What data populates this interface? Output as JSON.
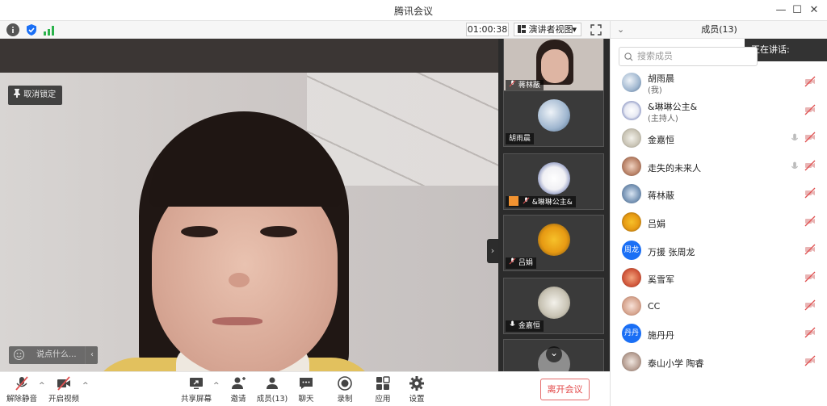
{
  "window": {
    "title": "腾讯会议",
    "minimize": "—",
    "maximize": "☐",
    "close": "✕"
  },
  "status": {
    "timer": "01:00:38",
    "view_mode": "演讲者视图",
    "view_caret": "▾"
  },
  "main_video": {
    "unlock_label": "取消锁定",
    "chat_placeholder": "说点什么...",
    "chat_arrow": "‹",
    "collapse_arrow": "›"
  },
  "strip": {
    "tiles": [
      {
        "name": "蒋林蔽"
      },
      {
        "name": "胡雨晨"
      },
      {
        "name": "&琳琳公主&"
      },
      {
        "name": "吕娟"
      },
      {
        "name": "金嘉恒"
      }
    ],
    "scroll_down": "⌄"
  },
  "panel": {
    "title": "成员(13)",
    "collapse": "⌄",
    "speaking_label": "正在讲话:",
    "search_placeholder": "搜索成员",
    "members": [
      {
        "name": "胡雨晨",
        "role": "(我)"
      },
      {
        "name": "&琳琳公主&",
        "role": "(主持人)"
      },
      {
        "name": "金嘉恒",
        "role": ""
      },
      {
        "name": "走失的未来人",
        "role": ""
      },
      {
        "name": "蒋林蔽",
        "role": ""
      },
      {
        "name": "吕娟",
        "role": ""
      },
      {
        "name": "万援 张周龙",
        "role": "",
        "avatar_text": "周龙"
      },
      {
        "name": "奚雪军",
        "role": ""
      },
      {
        "name": "CC",
        "role": ""
      },
      {
        "name": "施丹丹",
        "role": "",
        "avatar_text": "丹丹"
      },
      {
        "name": "泰山小学 陶睿",
        "role": ""
      }
    ]
  },
  "toolbar": {
    "unmute": "解除静音",
    "start_video": "开启视频",
    "share_screen": "共享屏幕",
    "invite": "邀请",
    "members": "成员(13)",
    "chat": "聊天",
    "record": "录制",
    "apps": "应用",
    "settings": "设置",
    "leave": "离开会议",
    "caret": "^"
  },
  "colors": {
    "accent_blue": "#1a6ff5",
    "leave_red": "#e34848",
    "muted_red": "#e05252"
  }
}
